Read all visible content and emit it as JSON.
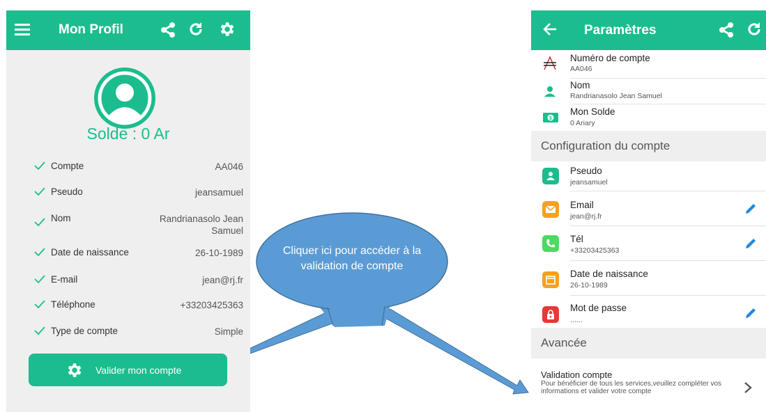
{
  "left": {
    "title": "Mon Profil",
    "solde": "Solde : 0 Ar",
    "rows": [
      {
        "label": "Compte",
        "value": "AA046"
      },
      {
        "label": "Pseudo",
        "value": "jeansamuel"
      },
      {
        "label": "Nom",
        "value": "Randrianasolo Jean Samuel"
      },
      {
        "label": "Date de naissance",
        "value": "26-10-1989"
      },
      {
        "label": "E-mail",
        "value": "jean@rj.fr"
      },
      {
        "label": "Téléphone",
        "value": "+33203425363"
      },
      {
        "label": "Type de compte",
        "value": "Simple"
      }
    ],
    "validate_label": "Valider mon compte"
  },
  "right": {
    "title": "Paramètres",
    "account_number_label": "Numéro de compte",
    "account_number_value": "AA046",
    "name_label": "Nom",
    "name_value": "Randrianasolo Jean Samuel",
    "balance_label": "Mon Solde",
    "balance_value": "0 Ariary",
    "section_config": "Configuration du compte",
    "pseudo_label": "Pseudo",
    "pseudo_value": "jeansamuel",
    "email_label": "Email",
    "email_value": "jean@rj.fr",
    "tel_label": "Tél",
    "tel_value": "+33203425363",
    "birth_label": "Date de naissance",
    "birth_value": "26-10-1989",
    "password_label": "Mot de passe",
    "password_value": "......",
    "section_advanced": "Avancée",
    "validation_label": "Validation compte",
    "validation_desc": "Pour bénéficier de tous les services,veuillez compléter vos informations et valider votre compte"
  },
  "callout": {
    "text": "Cliquer ici pour accéder à la validation de compte"
  },
  "colors": {
    "accent": "#1bbd8e",
    "callout": "#5b9bd5",
    "callout_border": "#41719c",
    "pseudo_icon": "#1bbd8e",
    "email_icon": "#f7a21b",
    "tel_icon": "#4cd964",
    "birth_icon": "#f7a21b",
    "password_icon": "#e53935"
  },
  "icons": [
    "menu-icon",
    "share-icon",
    "refresh-icon",
    "gear-icon",
    "avatar-icon",
    "check-icon",
    "back-arrow-icon",
    "account-number-icon",
    "person-icon",
    "money-icon",
    "pencil-icon",
    "chevron-right-icon"
  ]
}
